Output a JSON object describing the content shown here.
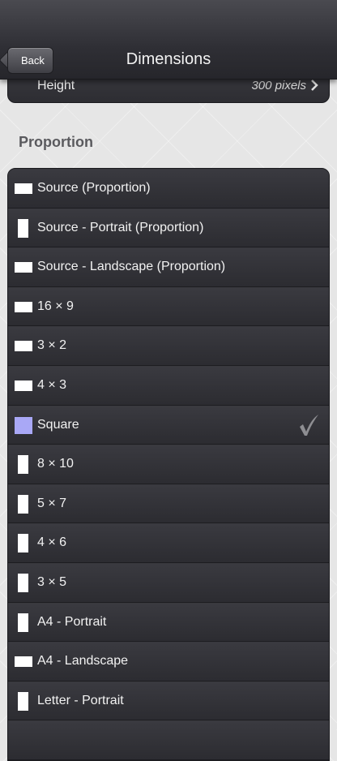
{
  "nav": {
    "back_label": "Back",
    "title": "Dimensions"
  },
  "height_row": {
    "label": "Height",
    "value": "300 pixels"
  },
  "section": {
    "title": "Proportion"
  },
  "items": [
    {
      "label": "Source (Proportion)",
      "swatch": "landscape",
      "selected": false
    },
    {
      "label": "Source - Portrait (Proportion)",
      "swatch": "portrait",
      "selected": false
    },
    {
      "label": "Source - Landscape (Proportion)",
      "swatch": "landscape",
      "selected": false
    },
    {
      "label": "16 × 9",
      "swatch": "landscape",
      "selected": false
    },
    {
      "label": "3 × 2",
      "swatch": "landscape",
      "selected": false
    },
    {
      "label": "4 × 3",
      "swatch": "landscape",
      "selected": false
    },
    {
      "label": "Square",
      "swatch": "square",
      "selected": true
    },
    {
      "label": "8 × 10",
      "swatch": "portrait",
      "selected": false
    },
    {
      "label": "5 × 7",
      "swatch": "portrait",
      "selected": false
    },
    {
      "label": "4 × 6",
      "swatch": "portrait",
      "selected": false
    },
    {
      "label": "3 × 5",
      "swatch": "portrait",
      "selected": false
    },
    {
      "label": "A4 - Portrait",
      "swatch": "portrait",
      "selected": false
    },
    {
      "label": "A4 - Landscape",
      "swatch": "landscape",
      "selected": false
    },
    {
      "label": "Letter - Portrait",
      "swatch": "portrait",
      "selected": false
    },
    {
      "label": "",
      "swatch": "none",
      "selected": false
    }
  ],
  "colors": {
    "selected_swatch": "#a9a8f6",
    "row_text": "#f2f2f2",
    "checkmark": "#8e8e92"
  }
}
